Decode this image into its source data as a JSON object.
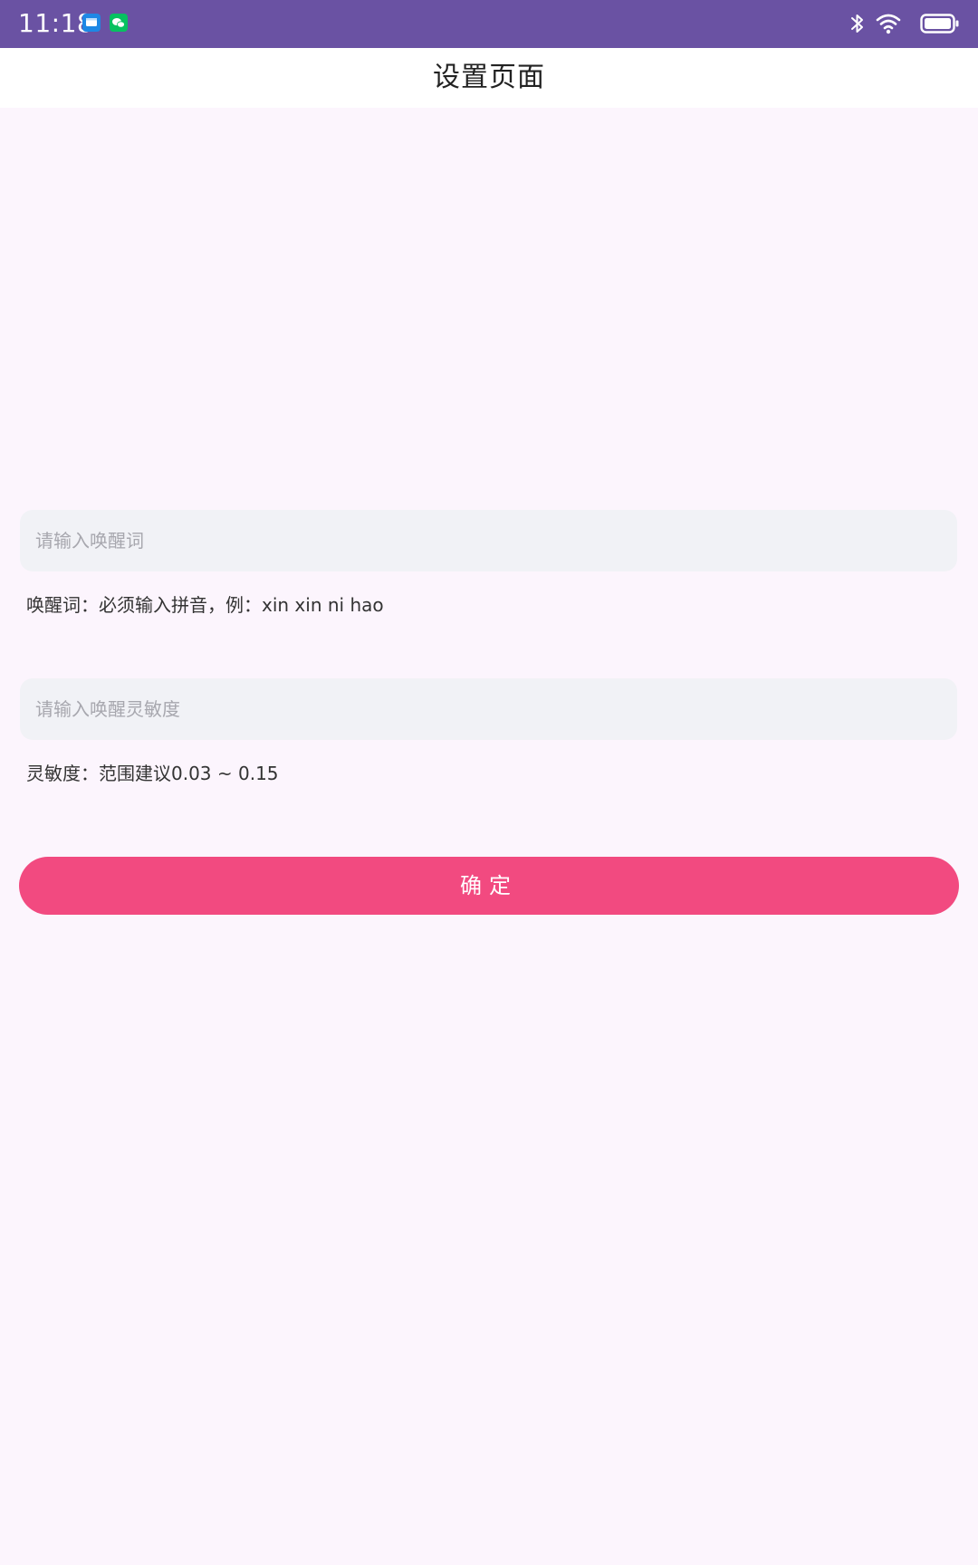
{
  "status_bar": {
    "time": "11:18",
    "notifications": [
      "message-app-icon",
      "wechat-icon"
    ],
    "right_icons": [
      "bluetooth-icon",
      "wifi-icon",
      "battery-icon"
    ],
    "background_color": "#6a52a3"
  },
  "header": {
    "title": "设置页面"
  },
  "form": {
    "wake_word": {
      "value": "",
      "placeholder": "请输入唤醒词",
      "hint": "唤醒词：必须输入拼音，例：xin xin ni hao"
    },
    "sensitivity": {
      "value": "",
      "placeholder": "请输入唤醒灵敏度",
      "hint": "灵敏度：范围建议0.03 ~ 0.15"
    },
    "confirm_label": "确定"
  },
  "colors": {
    "accent": "#f24a80",
    "page_background": "#fcf5fd",
    "input_background": "#f1f2f6"
  }
}
